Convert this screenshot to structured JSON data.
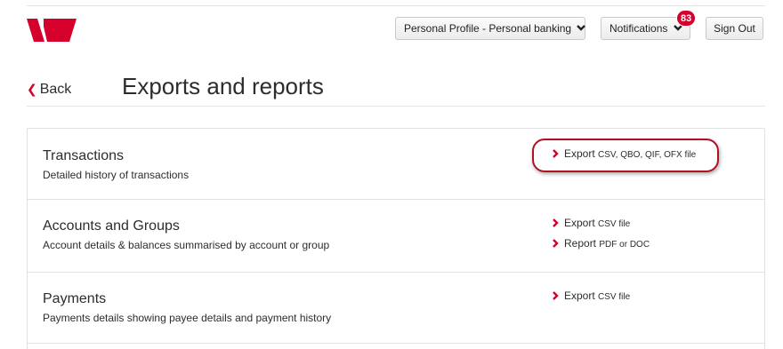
{
  "header": {
    "profile_label": "Personal Profile - Personal banking",
    "notifications_label": "Notifications",
    "notifications_count": "83",
    "signout_label": "Sign Out"
  },
  "nav": {
    "back_label": "Back",
    "page_title": "Exports and reports"
  },
  "sections": [
    {
      "title": "Transactions",
      "description": "Detailed history of transactions",
      "links": [
        {
          "action": "Export",
          "formats": "CSV, QBO, QIF, OFX file"
        }
      ]
    },
    {
      "title": "Accounts and Groups",
      "description": "Account details & balances summarised by account or group",
      "links": [
        {
          "action": "Export",
          "formats": "CSV file"
        },
        {
          "action": "Report",
          "formats": "PDF or DOC"
        }
      ]
    },
    {
      "title": "Payments",
      "description": "Payments details showing payee details and payment history",
      "links": [
        {
          "action": "Export",
          "formats": "CSV file"
        }
      ]
    }
  ],
  "colors": {
    "brand_red": "#d5002b",
    "highlight_red": "#b01020"
  },
  "icons": {
    "logo": "westpac-logo",
    "dropdown": "chevron-down-icon",
    "link_arrow": "chevron-right-icon",
    "back": "chevron-left-icon"
  }
}
